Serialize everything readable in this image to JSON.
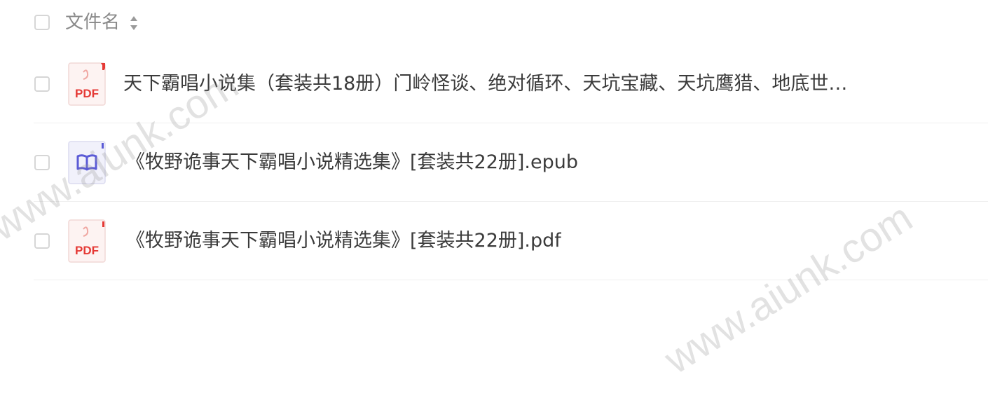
{
  "header": {
    "title": "文件名",
    "sort_icon": "sort-icon"
  },
  "files": [
    {
      "name": "天下霸唱小说集（套装共18册）门岭怪谈、绝对循环、天坑宝藏、天坑鹰猎、地底世…",
      "type": "pdf",
      "icon_label": "PDF"
    },
    {
      "name": "《牧野诡事天下霸唱小说精选集》[套装共22册].epub",
      "type": "epub",
      "icon_label": ""
    },
    {
      "name": "《牧野诡事天下霸唱小说精选集》[套装共22册].pdf",
      "type": "pdf",
      "icon_label": "PDF"
    }
  ],
  "watermark": {
    "text": "www.aiunk.com"
  },
  "colors": {
    "pdf": "#e53935",
    "epub": "#5b5bd6",
    "divider": "#efefef"
  }
}
